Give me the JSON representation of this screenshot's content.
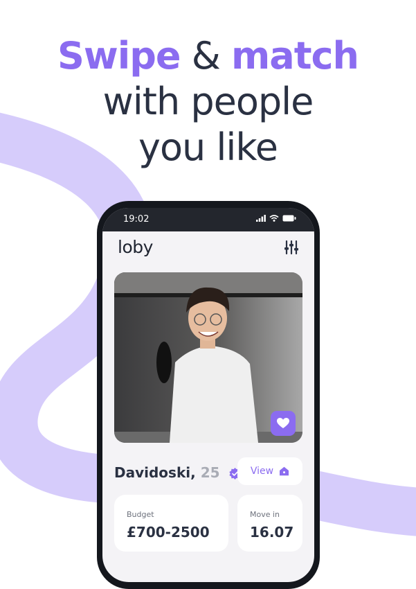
{
  "headline": {
    "word1": "Swipe",
    "joiner": "&",
    "word2": "match",
    "line2": "with people",
    "line3": "you like"
  },
  "colors": {
    "accent": "#8b6cf0",
    "swirl": "#d6ccfb",
    "text": "#2a3142"
  },
  "status_bar": {
    "time": "19:02",
    "icons": [
      "signal-icon",
      "wifi-icon",
      "battery-icon"
    ]
  },
  "app": {
    "logo": "loby",
    "filter_icon": "sliders-icon"
  },
  "profile": {
    "name": "Davidoski,",
    "age": "25",
    "verified_icon": "verified-badge-icon",
    "like_icon": "heart-icon",
    "view_label": "View",
    "view_icon": "home-icon"
  },
  "details": {
    "budget_label": "Budget",
    "budget_value": "£700-2500",
    "move_label": "Move in",
    "move_value": "16.07"
  }
}
